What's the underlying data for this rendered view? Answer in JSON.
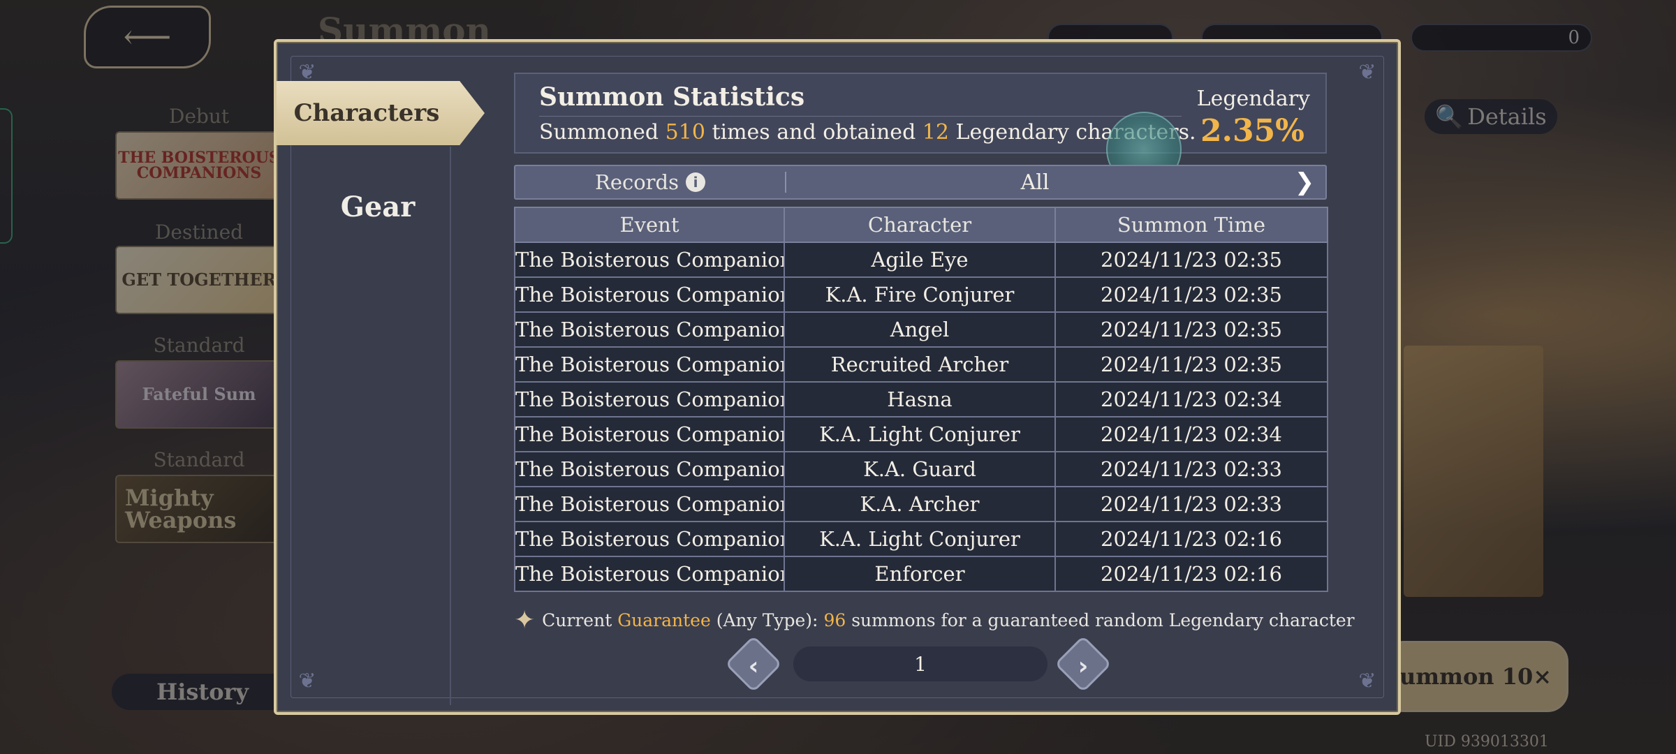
{
  "background": {
    "title": "Summon",
    "banner_labels": [
      "Debut",
      "Destined",
      "Standard",
      "Standard"
    ],
    "banners": [
      "THE BOISTEROUS COMPANIONS",
      "GET TOGETHER",
      "Fateful Sum",
      "Mighty Weapons"
    ],
    "details_label": "Details",
    "summon10_label": "ummon 10×",
    "history_label": "History",
    "currency_right": "0",
    "uid": "UID 939013301"
  },
  "tabs": {
    "characters": "Characters",
    "gear": "Gear"
  },
  "stats": {
    "title": "Summon Statistics",
    "prefix": "Summoned ",
    "count": "510",
    "middle": " times and obtained ",
    "legendary_count": "12",
    "suffix": " Legendary characters.",
    "legendary_label": "Legendary",
    "legendary_rate": "2.35%"
  },
  "records_bar": {
    "label": "Records",
    "filter": "All"
  },
  "table": {
    "columns": [
      "Event",
      "Character",
      "Summon Time"
    ],
    "rows": [
      {
        "event": "The Boisterous Companions",
        "character": "Agile Eye",
        "time": "2024/11/23 02:35"
      },
      {
        "event": "The Boisterous Companions",
        "character": "K.A. Fire Conjurer",
        "time": "2024/11/23 02:35"
      },
      {
        "event": "The Boisterous Companions",
        "character": "Angel",
        "time": "2024/11/23 02:35"
      },
      {
        "event": "The Boisterous Companions",
        "character": "Recruited Archer",
        "time": "2024/11/23 02:35"
      },
      {
        "event": "The Boisterous Companions",
        "character": "Hasna",
        "time": "2024/11/23 02:34"
      },
      {
        "event": "The Boisterous Companions",
        "character": "K.A. Light Conjurer",
        "time": "2024/11/23 02:34"
      },
      {
        "event": "The Boisterous Companions",
        "character": "K.A. Guard",
        "time": "2024/11/23 02:33"
      },
      {
        "event": "The Boisterous Companions",
        "character": "K.A. Archer",
        "time": "2024/11/23 02:33"
      },
      {
        "event": "The Boisterous Companions",
        "character": "K.A. Light Conjurer",
        "time": "2024/11/23 02:16"
      },
      {
        "event": "The Boisterous Companions",
        "character": "Enforcer",
        "time": "2024/11/23 02:16"
      }
    ]
  },
  "guarantee": {
    "prefix": "Current ",
    "keyword": "Guarantee",
    "middle": " (Any Type): ",
    "count": "96",
    "suffix": " summons for a guaranteed random Legendary character"
  },
  "pager": {
    "page": "1"
  },
  "colors": {
    "accent_gold": "#f2b54a",
    "rare_purple": "#c9a9ff",
    "frame_beige": "#d8c9a0"
  }
}
